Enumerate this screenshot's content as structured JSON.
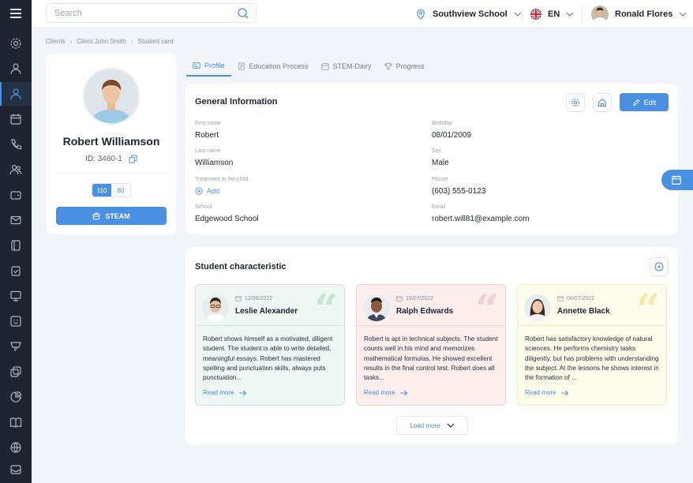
{
  "topbar": {
    "search_placeholder": "Search",
    "school": "Southview School",
    "language": "EN",
    "user_name": "Ronald Flores"
  },
  "breadcrumb": [
    "Clients",
    "Client John Smith",
    "Student card"
  ],
  "profile": {
    "name": "Robert Williamson",
    "id": "ID: 3460-1",
    "score_active": "110",
    "score_other": "80",
    "steam_label": "STEAM"
  },
  "tabs": [
    "Profile",
    "Education Process",
    "STEM-Dairy",
    "Progress"
  ],
  "general": {
    "title": "General Information",
    "edit_label": "Edit",
    "fields": {
      "first_name_label": "First name",
      "first_name": "Robert",
      "last_name_label": "Last name",
      "last_name": "Williamson",
      "treatment_label": "Treatment to the child",
      "treatment_add": "Add",
      "school_label": "School",
      "school": "Edgewood School",
      "birthday_label": "Birthday",
      "birthday": "08/01/2009",
      "sex_label": "Sex",
      "sex": "Male",
      "phone_label": "Phone",
      "phone": "(603) 555-0123",
      "email_label": "Email",
      "email": "robert.will81@example.com"
    }
  },
  "characteristic": {
    "title": "Student characteristic",
    "read_more": "Read more",
    "load_more": "Load more",
    "cards": [
      {
        "date": "12/08/2022",
        "name": "Leslie Alexander",
        "text": "Robert shows himself as a motivated, diligent student. The student is able to write detailed, meaningful essays. Robert has mastered spelling and punctuation skills, always puts punctuation...",
        "bg": "#eef7f3",
        "border": "#cfe6dc",
        "quote": "#c9e5d8"
      },
      {
        "date": "10/07/2022",
        "name": "Ralph Edwards",
        "text": "Robert is apt in technical subjects. The student counts well in his mind and memorizes mathematical formulas. He showed excellent results in the final control test. Robert does all tasks...",
        "bg": "#fdeeee",
        "border": "#f4d1d1",
        "quote": "#f3cfcf"
      },
      {
        "date": "06/07/2022",
        "name": "Annette Black",
        "text": "Robert has satisfactory knowledge of natural sciences. He performs chemistry tasks diligently, but has problems with understanding the subject. At the lessons he shows interest in the formation of ...",
        "bg": "#fdfbea",
        "border": "#f1ebbd",
        "quote": "#f1eab0"
      }
    ]
  },
  "colors": {
    "accent": "#4a90e2",
    "sidebar": "#1f2430",
    "background": "#f1f4f9"
  }
}
